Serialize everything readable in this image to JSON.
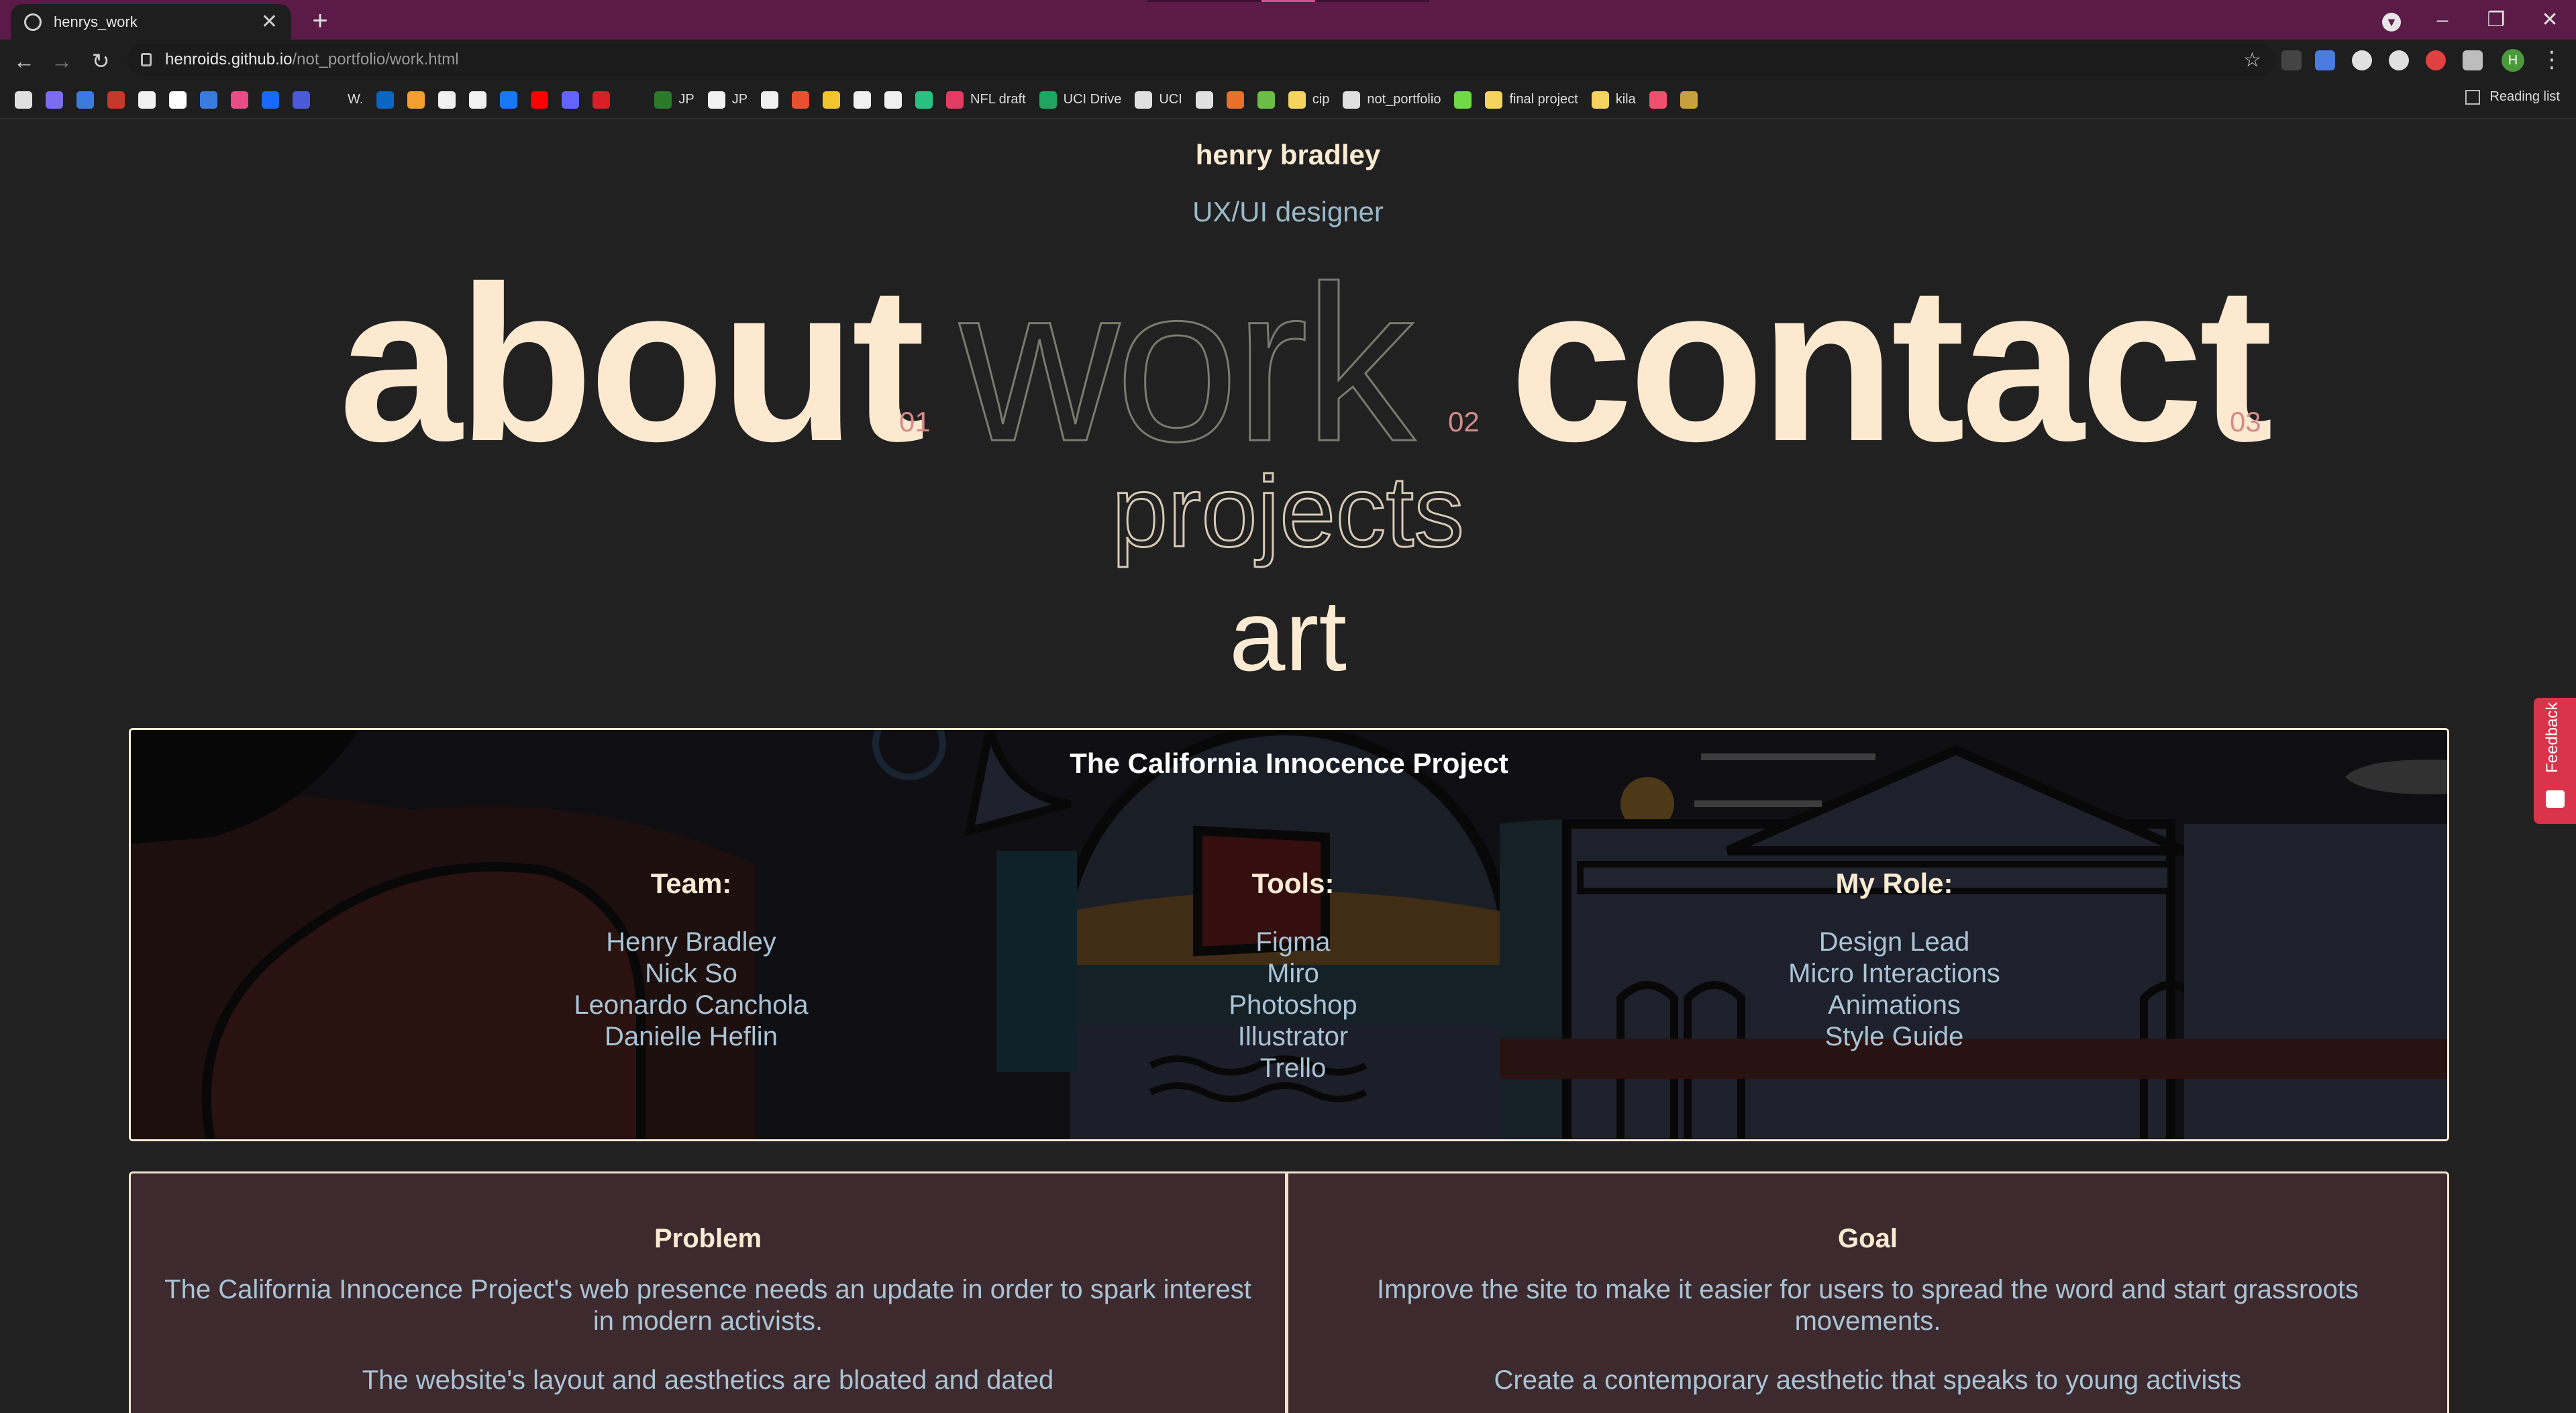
{
  "browser": {
    "tab_title": "henrys_work",
    "tab_close": "✕",
    "new_tab": "+",
    "url_host": "henroids.github.io",
    "url_path": "/not_portfolio/work.html",
    "back": "←",
    "forward": "→",
    "reload": "↻",
    "star": "☆",
    "menu": "⋮",
    "profile_initial": "H",
    "window_min": "–",
    "window_max": "❐",
    "window_close": "✕",
    "download": "▼",
    "reading_list": "Reading list",
    "bookmarks": [
      {
        "label": "",
        "color": "#e0e0e0"
      },
      {
        "label": "",
        "color": "#7d6cf0"
      },
      {
        "label": "",
        "color": "#3b7be0"
      },
      {
        "label": "",
        "color": "#c0392b"
      },
      {
        "label": "",
        "color": "#f0f0f0"
      },
      {
        "label": "",
        "color": "#ffffff"
      },
      {
        "label": "",
        "color": "#3b7be0"
      },
      {
        "label": "",
        "color": "#e94c89"
      },
      {
        "label": "",
        "color": "#1769ff"
      },
      {
        "label": "",
        "color": "#4b5ad8"
      },
      {
        "label": "W.",
        "color": "#1e1e1e"
      },
      {
        "label": "",
        "color": "#0a66c2"
      },
      {
        "label": "",
        "color": "#f4a030"
      },
      {
        "label": "",
        "color": "#f0f0f0"
      },
      {
        "label": "",
        "color": "#f0f0f0"
      },
      {
        "label": "",
        "color": "#1877f2"
      },
      {
        "label": "",
        "color": "#ff0000"
      },
      {
        "label": "",
        "color": "#6364ff"
      },
      {
        "label": "",
        "color": "#d81f26"
      },
      {
        "label": "",
        "color": "#1e1e1e"
      },
      {
        "label": "JP",
        "color": "#2a7a2a"
      },
      {
        "label": "JP",
        "color": "#f0f0f0"
      },
      {
        "label": "",
        "color": "#f0f0f0"
      },
      {
        "label": "",
        "color": "#e85030"
      },
      {
        "label": "",
        "color": "#f4c430"
      },
      {
        "label": "",
        "color": "#f0f0f0"
      },
      {
        "label": "",
        "color": "#f0f0f0"
      },
      {
        "label": "",
        "color": "#27c281"
      },
      {
        "label": "NFL draft",
        "color": "#e33b63"
      },
      {
        "label": "UCI Drive",
        "color": "#1fa463"
      },
      {
        "label": "UCI",
        "color": "#e0e0e0"
      },
      {
        "label": "",
        "color": "#e0e0e0"
      },
      {
        "label": "",
        "color": "#e8702a"
      },
      {
        "label": "",
        "color": "#6bbd45"
      },
      {
        "label": "cip",
        "color": "#f4d35e"
      },
      {
        "label": "not_portfolio",
        "color": "#e0e0e0"
      },
      {
        "label": "",
        "color": "#6fda44"
      },
      {
        "label": "final project",
        "color": "#f4d35e"
      },
      {
        "label": "kila",
        "color": "#f4d35e"
      },
      {
        "label": "",
        "color": "#f0506e"
      },
      {
        "label": "",
        "color": "#c8a040"
      }
    ]
  },
  "header": {
    "name": "henry bradley",
    "subtitle": "UX/UI designer"
  },
  "nav": {
    "about": "about",
    "about_num": "01",
    "work": "work",
    "work_num": "02",
    "contact": "contact",
    "contact_num": "03",
    "projects": "projects",
    "art": "art"
  },
  "project": {
    "title": "The California Innocence Project",
    "team_head": "Team:",
    "team": [
      "Henry Bradley",
      "Nick So",
      "Leonardo Canchola",
      "Danielle Heflin"
    ],
    "tools_head": "Tools:",
    "tools": [
      "Figma",
      "Miro",
      "Photoshop",
      "Illustrator",
      "Trello"
    ],
    "role_head": "My Role:",
    "role": [
      "Design Lead",
      "Micro Interactions",
      "Animations",
      "Style Guide"
    ]
  },
  "problem": {
    "head": "Problem",
    "text": "The California Innocence Project's web presence needs an update in order to spark interest in modern activists.",
    "text2": "The website's layout and aesthetics are bloated and dated"
  },
  "goal": {
    "head": "Goal",
    "text": "Improve the site to make it easier for users to spread the word and start grassroots movements.",
    "text2": "Create a contemporary aesthetic that speaks to young activists"
  },
  "feedback": {
    "label": "Feedback"
  },
  "colors": {
    "tabbar": "#5b1a47",
    "page_bg": "#212121",
    "cream": "#fbebd3",
    "blue_text": "#a9c3d4",
    "accent_num": "#d58a8a",
    "card_bg": "#3d2a2e",
    "feedback": "#d9344a"
  }
}
